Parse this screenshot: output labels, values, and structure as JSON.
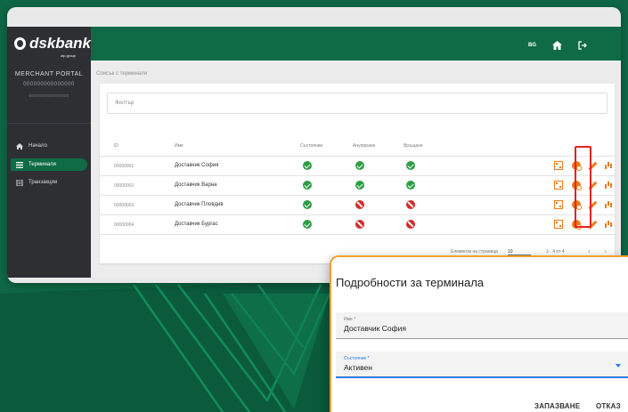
{
  "brand": {
    "logo_text": "dskbank",
    "logo_sub": "otp group",
    "portal_name": "MERCHANT PORTAL",
    "merchant_id": "000000000000000",
    "merchant_sub": "000000000000000"
  },
  "topbar": {
    "language": "BG"
  },
  "sidebar": {
    "items": [
      {
        "label": "Начало",
        "icon": "home-icon"
      },
      {
        "label": "Терминали",
        "icon": "list-icon"
      },
      {
        "label": "Транзакции",
        "icon": "receipt-icon"
      }
    ]
  },
  "breadcrumb": "Списък с терминали",
  "filter": {
    "placeholder": "Филтър"
  },
  "table": {
    "headers": [
      "ID",
      "Име",
      "Състояние",
      "Анулиране",
      "Връщане"
    ],
    "rows": [
      {
        "id": "00000001",
        "name": "Доставчик София",
        "state": "ok",
        "cancel": "ok",
        "refund": "ok"
      },
      {
        "id": "00000002",
        "name": "Доставчик Варна",
        "state": "ok",
        "cancel": "ok",
        "refund": "ok"
      },
      {
        "id": "00000003",
        "name": "Доставчик Пловдив",
        "state": "ok",
        "cancel": "no",
        "refund": "no"
      },
      {
        "id": "00000004",
        "name": "Доставчик Бургас",
        "state": "ok",
        "cancel": "no",
        "refund": "no"
      }
    ]
  },
  "pager": {
    "per_page_label": "Елементи на страница",
    "per_page_value": "10",
    "range": "1 - 4 от 4"
  },
  "dialog": {
    "title": "Подробности за терминала",
    "name_label": "Име *",
    "name_value": "Доставчик София",
    "state_label": "Състояние *",
    "state_value": "Активен",
    "save_label": "ЗАПАЗВАНЕ",
    "cancel_label": "ОТКАЗ"
  },
  "colors": {
    "brand_green": "#0e6b45",
    "accent_orange": "#f07a1a",
    "ok_green": "#2e9e45",
    "no_red": "#d72a2a",
    "highlight_red": "#e02424",
    "dialog_border": "#f0a030",
    "focus_blue": "#2c7be5"
  }
}
